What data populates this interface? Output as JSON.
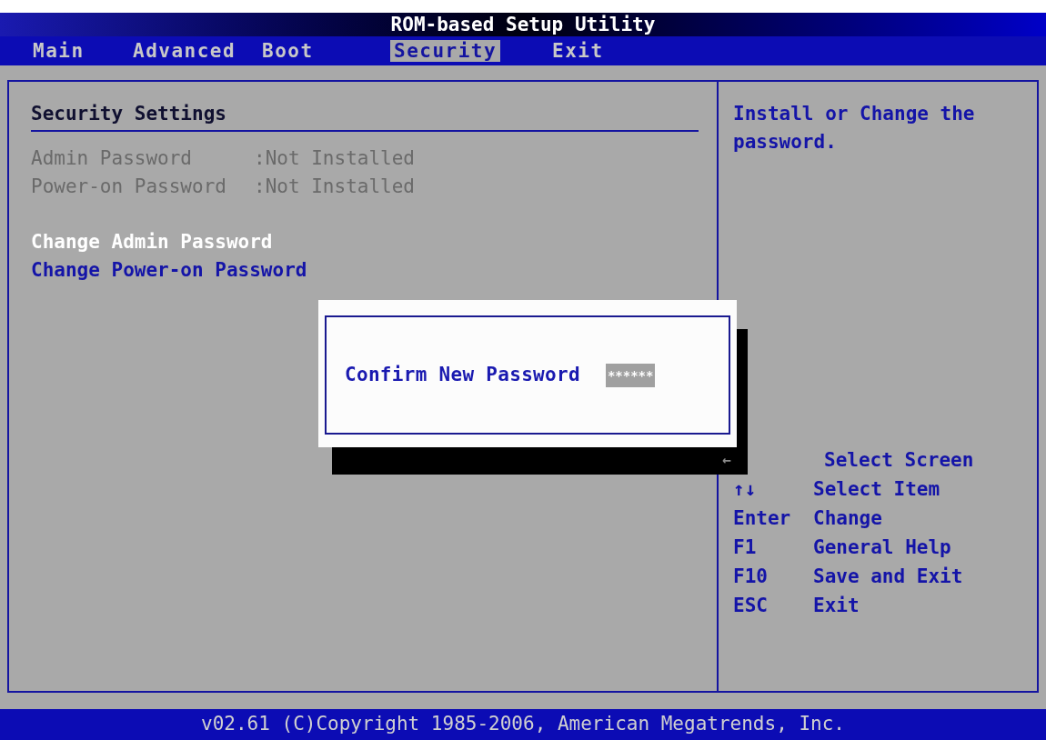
{
  "window": {
    "title": "ROM-based Setup Utility"
  },
  "tabs": [
    {
      "label": "Main",
      "selected": false
    },
    {
      "label": "Advanced",
      "selected": false
    },
    {
      "label": "Boot",
      "selected": false
    },
    {
      "label": "Security",
      "selected": true
    },
    {
      "label": "Exit",
      "selected": false
    }
  ],
  "panel": {
    "heading": "Security Settings",
    "items": [
      {
        "kind": "info",
        "label": "Admin Password",
        "value": ":Not Installed",
        "disabled": true
      },
      {
        "kind": "info",
        "label": "Power-on Password",
        "value": ":Not Installed",
        "disabled": true
      },
      {
        "kind": "action",
        "label": "Change Admin Password",
        "selected": true
      },
      {
        "kind": "action",
        "label": "Change Power-on Password",
        "selected": false
      }
    ]
  },
  "help": {
    "text": "Install or Change the password.",
    "keys": [
      {
        "action": "Select Screen"
      },
      {
        "key": "↑↓",
        "action": "Select Item"
      },
      {
        "key": "Enter",
        "action": "Change"
      },
      {
        "key": "F1",
        "action": "General Help"
      },
      {
        "key": "F10",
        "action": "Save and Exit"
      },
      {
        "key": "ESC",
        "action": "Exit"
      }
    ]
  },
  "dialog": {
    "label": "Confirm New Password",
    "value": "******",
    "shadow_text": "←"
  },
  "footer": "v02.61 (C)Copyright 1985-2006, American Megatrends, Inc."
}
